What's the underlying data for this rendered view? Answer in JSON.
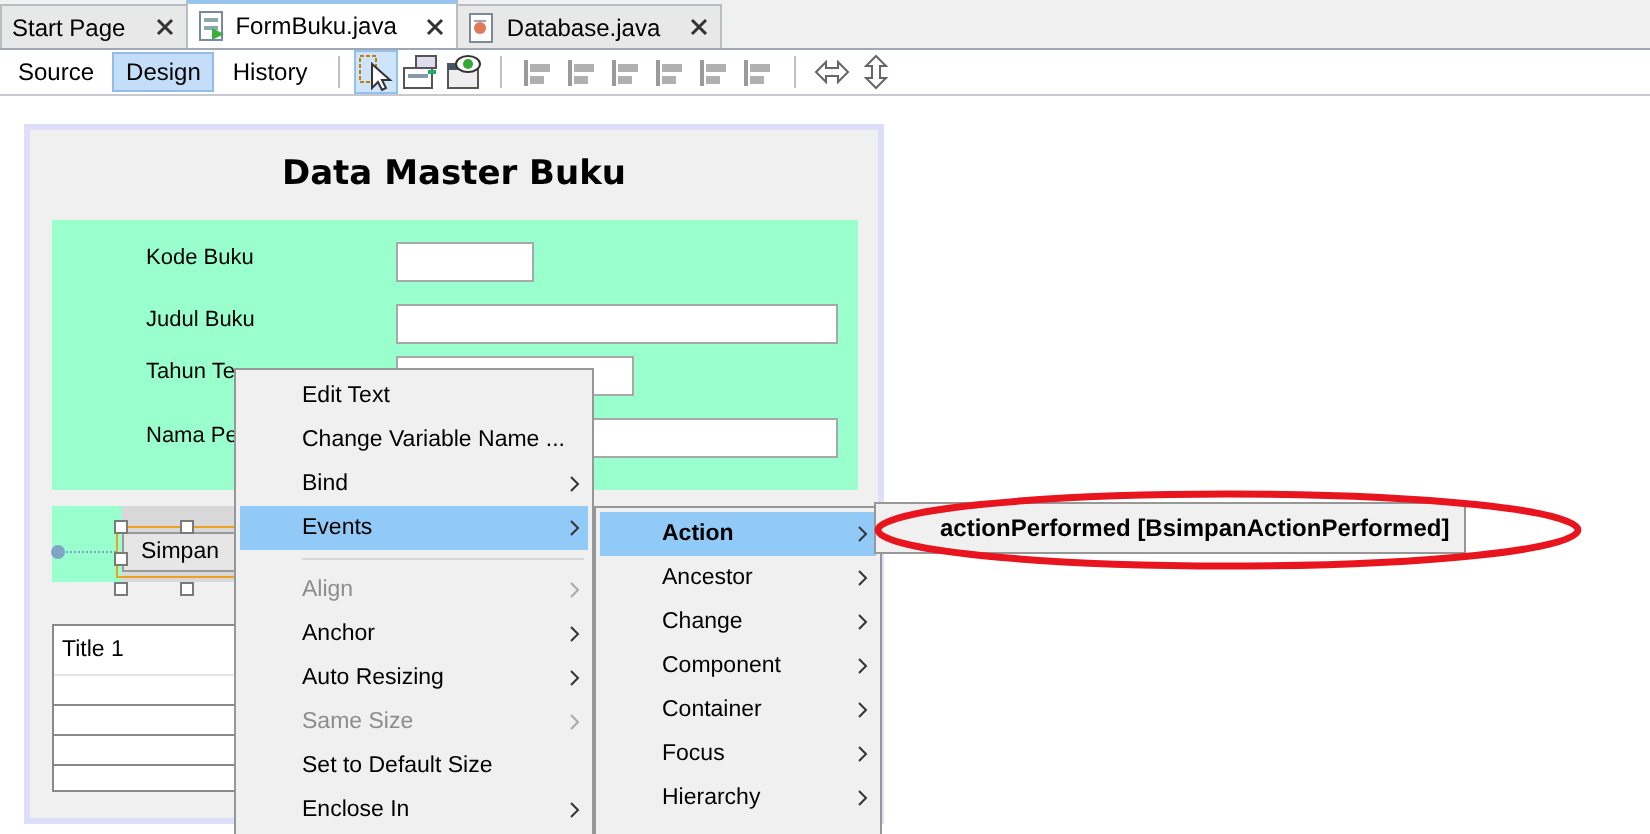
{
  "tabs": [
    {
      "label": "Start Page",
      "selected": false
    },
    {
      "label": "FormBuku.java",
      "selected": true
    },
    {
      "label": "Database.java",
      "selected": false
    }
  ],
  "view_tabs": [
    {
      "label": "Source",
      "selected": false
    },
    {
      "label": "Design",
      "selected": true
    },
    {
      "label": "History",
      "selected": false
    }
  ],
  "form": {
    "title": "Data Master Buku",
    "fields": [
      {
        "label": "Kode Buku"
      },
      {
        "label": "Judul Buku"
      },
      {
        "label": "Tahun Te"
      },
      {
        "label": "Nama Pe"
      }
    ],
    "button": {
      "label": "Simpan",
      "selected": true
    },
    "table": {
      "columns": [
        "Title 1"
      ]
    }
  },
  "context_menu": {
    "items": [
      {
        "kind": "item",
        "label": "Edit Text",
        "disabled": false,
        "submenu": false,
        "selected": false
      },
      {
        "kind": "item",
        "label": "Change Variable Name ...",
        "disabled": false,
        "submenu": false,
        "selected": false
      },
      {
        "kind": "item",
        "label": "Bind",
        "disabled": false,
        "submenu": true,
        "selected": false
      },
      {
        "kind": "item",
        "label": "Events",
        "disabled": false,
        "submenu": true,
        "selected": true
      },
      {
        "kind": "separator"
      },
      {
        "kind": "item",
        "label": "Align",
        "disabled": true,
        "submenu": true,
        "selected": false
      },
      {
        "kind": "item",
        "label": "Anchor",
        "disabled": false,
        "submenu": true,
        "selected": false
      },
      {
        "kind": "item",
        "label": "Auto Resizing",
        "disabled": false,
        "submenu": true,
        "selected": false
      },
      {
        "kind": "item",
        "label": "Same Size",
        "disabled": true,
        "submenu": true,
        "selected": false
      },
      {
        "kind": "item",
        "label": "Set to Default Size",
        "disabled": false,
        "submenu": false,
        "selected": false
      },
      {
        "kind": "item",
        "label": "Enclose In",
        "disabled": false,
        "submenu": true,
        "selected": false
      }
    ]
  },
  "events_submenu": {
    "items": [
      {
        "label": "Action",
        "selected": true
      },
      {
        "label": "Ancestor",
        "selected": false
      },
      {
        "label": "Change",
        "selected": false
      },
      {
        "label": "Component",
        "selected": false
      },
      {
        "label": "Container",
        "selected": false
      },
      {
        "label": "Focus",
        "selected": false
      },
      {
        "label": "Hierarchy",
        "selected": false
      }
    ]
  },
  "action_submenu": {
    "items": [
      "actionPerformed [BsimpanActionPerformed]"
    ]
  }
}
